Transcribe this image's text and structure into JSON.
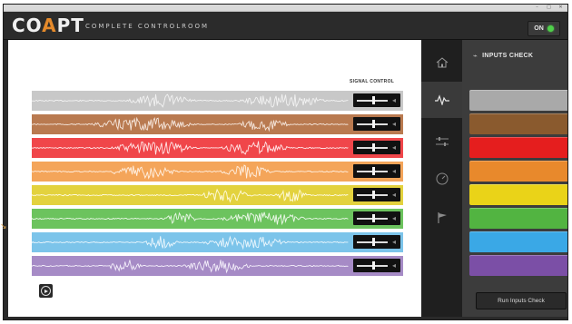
{
  "window": {
    "minimize": "–",
    "maximize": "□",
    "close": "✕"
  },
  "header": {
    "logo_pre": "CO",
    "logo_accent": "A",
    "logo_post": "PT",
    "subtitle": "COMPLETE CONTROLROOM",
    "power_label": "ON"
  },
  "main": {
    "signal_control_label": "SIGNAL CONTROL",
    "channels": [
      {
        "color": "#c8c8c8",
        "wave": "#f2f2f2",
        "slider": 0.55
      },
      {
        "color": "#b97a50",
        "wave": "#f5e6dc",
        "slider": 0.55
      },
      {
        "color": "#f0464a",
        "wave": "#ffe5e6",
        "slider": 0.55
      },
      {
        "color": "#f4a55a",
        "wave": "#fff0e2",
        "slider": 0.55
      },
      {
        "color": "#e3d23e",
        "wave": "#fffbe0",
        "slider": 0.55
      },
      {
        "color": "#6cc35e",
        "wave": "#ecf8e9",
        "slider": 0.55
      },
      {
        "color": "#7cc4ea",
        "wave": "#eaf6fd",
        "slider": 0.55
      },
      {
        "color": "#a68bc6",
        "wave": "#f3eefa",
        "slider": 0.55
      }
    ],
    "play_icon": "play-icon"
  },
  "nav": {
    "items": [
      "home-icon",
      "signal-icon",
      "sliders-icon",
      "gauge-icon",
      "flag-icon"
    ],
    "active": 1
  },
  "panel": {
    "title": "INPUTS CHECK",
    "title_icon": "signal-icon",
    "swatches": [
      "#a9a9a9",
      "#8a5a2e",
      "#e51e1e",
      "#e8892c",
      "#ead318",
      "#52b441",
      "#3aa8e6",
      "#7b4fa6"
    ],
    "run_button_label": "Run Inputs Check"
  },
  "side_marker": "↘"
}
